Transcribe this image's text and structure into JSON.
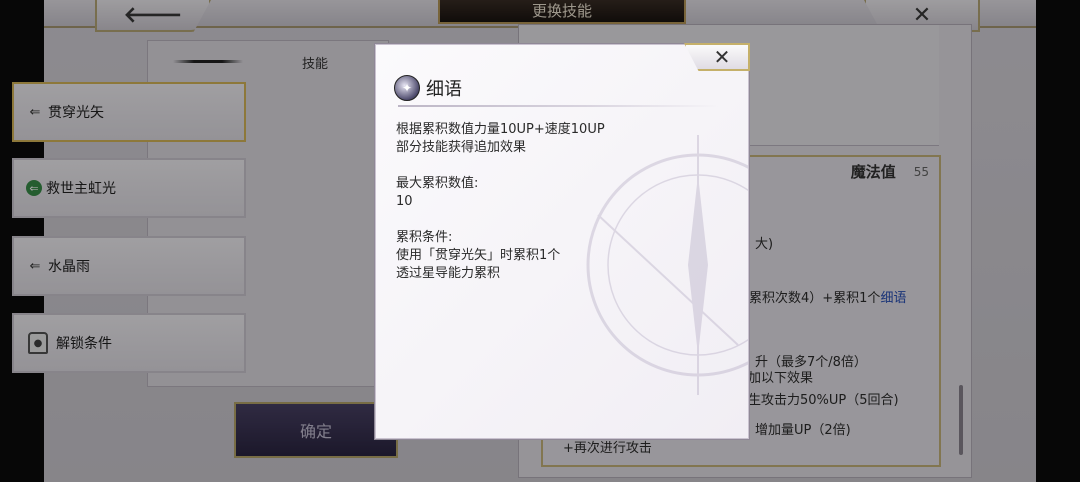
{
  "topbar": {
    "title": "更换技能",
    "back_glyph": "🡐",
    "close_glyph": "✕"
  },
  "left_panel": {
    "header": "技能",
    "skills": [
      {
        "label": "贯穿光矢",
        "icon": "arrow-left-icon"
      },
      {
        "label": "救世主虹光",
        "icon": "green-arrow-icon"
      },
      {
        "label": "水晶雨",
        "icon": "arrow-left-icon"
      },
      {
        "label": "解锁条件",
        "icon": "lock-icon"
      }
    ],
    "confirm_label": "确定"
  },
  "right_panel": {
    "mp_label": "魔法值",
    "mp_value": "55",
    "lines": {
      "l1": "大)",
      "l2a": "累积次数4）+累积1个",
      "l2b": "细语",
      "l3": "升（最多7个/8倍）",
      "l4": "加以下效果",
      "l5": "生攻击力50%UP（5回合)",
      "l6": "增加量UP（2倍)",
      "l7": "+再次进行攻击"
    }
  },
  "dialog": {
    "title": "细语",
    "close_glyph": "✕",
    "desc_line1": "根据累积数值力量10UP+速度10UP",
    "desc_line2": "部分技能获得追加效果",
    "max_label": "最大累积数值:",
    "max_value": "10",
    "cond_label": "累积条件:",
    "cond_line1": "使用「贯穿光矢」时累积1个",
    "cond_line2": "透过星导能力累积"
  },
  "colors": {
    "gold": "#c5b06a",
    "link": "#2850b8",
    "confirm_bg": "#2b2542"
  }
}
